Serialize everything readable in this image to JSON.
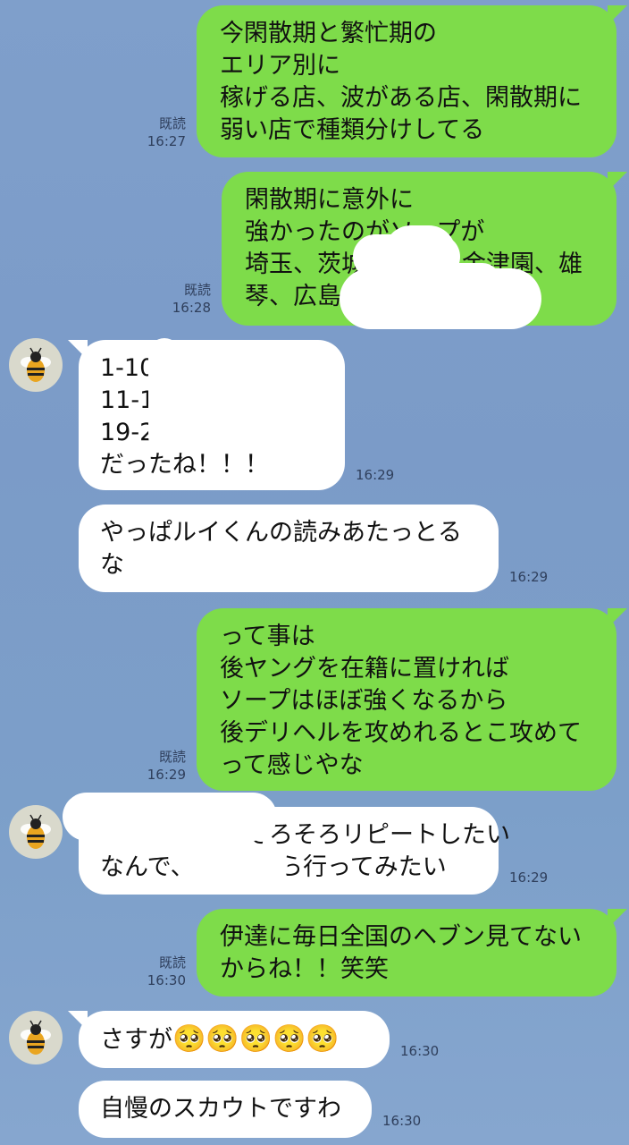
{
  "avatar_icon": "bee-icon",
  "messages": [
    {
      "dir": "out",
      "lines": [
        "今閑散期と繁忙期の",
        "エリア別に",
        "稼げる店、波がある店、閑散期に",
        "弱い店で種類分けしてる"
      ],
      "read": "既読",
      "time": "16:27"
    },
    {
      "dir": "out",
      "lines": [
        "閑散期に意外に",
        "強かったのがソープが",
        "埼玉、茨城　　　　金津園、雄",
        "琴、広島"
      ],
      "read": "既読",
      "time": "16:28"
    },
    {
      "dir": "in",
      "lines": [
        "1-10",
        "11-18",
        "19-29",
        "だったね！！！"
      ],
      "time": "16:29"
    },
    {
      "dir": "in",
      "lines": [
        "やっぱルイくんの読みあたっとる",
        "な"
      ],
      "time": "16:29"
    },
    {
      "dir": "out",
      "lines": [
        "って事は",
        "後ヤングを在籍に置ければ",
        "ソープはほぼ強くなるから",
        "後デリヘルを攻めれるとこ攻めて",
        "って感じやな"
      ],
      "read": "既読",
      "time": "16:29"
    },
    {
      "dir": "in",
      "lines": [
        "　　　　　　そろそろリピートしたい",
        "なんで、　　　　ら行ってみたい"
      ],
      "time": "16:29"
    },
    {
      "dir": "out",
      "lines": [
        "伊達に毎日全国のヘブン見てない",
        "からね！！笑笑"
      ],
      "read": "既読",
      "time": "16:30"
    },
    {
      "dir": "in",
      "text": "さすが",
      "emoji": "🥺🥺🥺🥺🥺",
      "time": "16:30"
    },
    {
      "dir": "in",
      "lines": [
        "自慢のスカウトですわ"
      ],
      "time": "16:30"
    }
  ]
}
